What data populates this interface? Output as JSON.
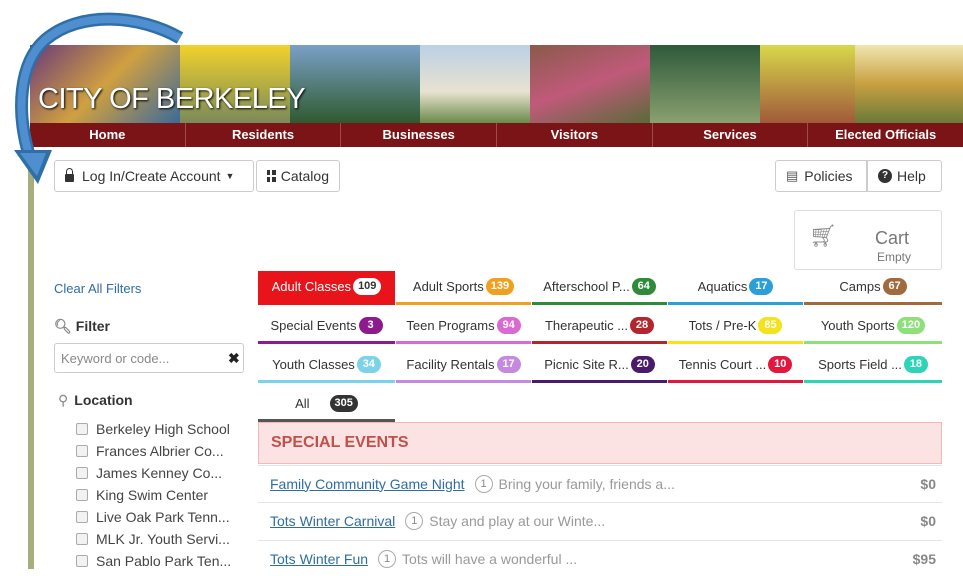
{
  "banner": {
    "title": "CITY OF BERKELEY"
  },
  "nav": [
    "Home",
    "Residents",
    "Businesses",
    "Visitors",
    "Services",
    "Elected Officials"
  ],
  "toolbar": {
    "login_label": "Log In/Create Account",
    "catalog_label": "Catalog",
    "policies_label": "Policies",
    "help_label": "Help"
  },
  "cart": {
    "label": "Cart",
    "status": "Empty"
  },
  "sidebar": {
    "clear_filters": "Clear All Filters",
    "filter_title": "Filter",
    "search_placeholder": "Keyword or code...",
    "location_title": "Location",
    "locations": [
      "Berkeley High School",
      "Frances Albrier Co...",
      "James Kenney Co...",
      "King Swim Center",
      "Live Oak Park Tenn...",
      "MLK Jr. Youth Servi...",
      "San Pablo Park Ten..."
    ]
  },
  "categories": [
    {
      "label": "Adult Classes",
      "count": "109",
      "color": "#e8141a",
      "active": true
    },
    {
      "label": "Adult Sports",
      "count": "139",
      "color": "#f0a01e"
    },
    {
      "label": "Afterschool P...",
      "count": "64",
      "color": "#2e8b3a"
    },
    {
      "label": "Aquatics",
      "count": "17",
      "color": "#2a9fd8"
    },
    {
      "label": "Camps",
      "count": "67",
      "color": "#a06a3c"
    },
    {
      "label": "Special Events",
      "count": "3",
      "color": "#8e1b8e"
    },
    {
      "label": "Teen Programs",
      "count": "94",
      "color": "#d96ad2"
    },
    {
      "label": "Therapeutic ...",
      "count": "28",
      "color": "#b3262e"
    },
    {
      "label": "Tots / Pre-K",
      "count": "85",
      "color": "#f3e21c"
    },
    {
      "label": "Youth Sports",
      "count": "120",
      "color": "#8ee07a"
    },
    {
      "label": "Youth Classes",
      "count": "34",
      "color": "#7bd3ea"
    },
    {
      "label": "Facility Rentals",
      "count": "17",
      "color": "#c58ae0"
    },
    {
      "label": "Picnic Site R...",
      "count": "20",
      "color": "#4a1a6b"
    },
    {
      "label": "Tennis Court ...",
      "count": "10",
      "color": "#e3173e"
    },
    {
      "label": "Sports Field ...",
      "count": "18",
      "color": "#2dd4b8"
    }
  ],
  "all_tab": {
    "label": "All",
    "count": "305"
  },
  "section": {
    "title": "SPECIAL EVENTS"
  },
  "events": [
    {
      "title": "Family Community Game Night",
      "num": "1",
      "desc": "Bring your family, friends a...",
      "price": "$0"
    },
    {
      "title": "Tots Winter Carnival",
      "num": "1",
      "desc": "Stay and play at our Winte...",
      "price": "$0"
    },
    {
      "title": "Tots Winter Fun",
      "num": "1",
      "desc": "Tots will have a wonderful ...",
      "price": "$95"
    }
  ]
}
